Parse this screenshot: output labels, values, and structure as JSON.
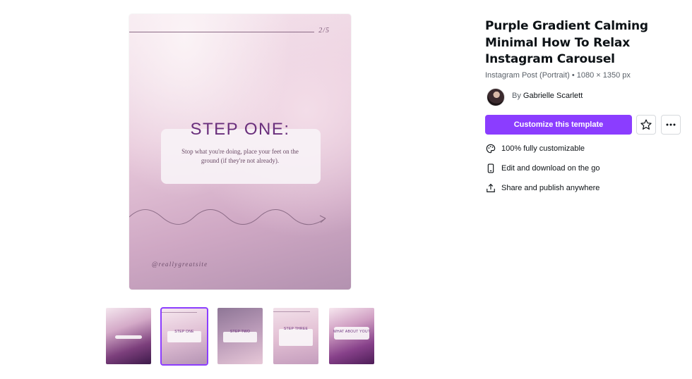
{
  "template": {
    "title": "Purple Gradient Calming Minimal How To Relax Instagram Carousel",
    "meta": "Instagram Post (Portrait) • 1080 × 1350 px",
    "author_prefix": "By",
    "author_name": "Gabrielle Scarlett"
  },
  "actions": {
    "customize_label": "Customize this template",
    "favorite_icon": "star-icon",
    "more_icon": "more-horizontal-icon"
  },
  "features": [
    {
      "icon": "palette-icon",
      "label": "100% fully customizable"
    },
    {
      "icon": "phone-icon",
      "label": "Edit and download on the go"
    },
    {
      "icon": "share-icon",
      "label": "Share and publish anywhere"
    }
  ],
  "preview": {
    "page_number": "2/5",
    "heading": "STEP ONE:",
    "body": "Stop what you're doing, place your feet on the ground (if they're not already).",
    "handle": "@reallygreatsite"
  },
  "thumbnails": [
    {
      "label": "",
      "selected": false
    },
    {
      "label": "STEP ONE",
      "selected": true
    },
    {
      "label": "STEP TWO",
      "selected": false
    },
    {
      "label": "STEP THREE",
      "selected": false
    },
    {
      "label": "WHAT ABOUT YOU?",
      "selected": false
    }
  ],
  "colors": {
    "accent": "#8b3dff",
    "heading_purple": "#6a2f7c",
    "text": "#0d1216",
    "muted": "#5a6169"
  }
}
